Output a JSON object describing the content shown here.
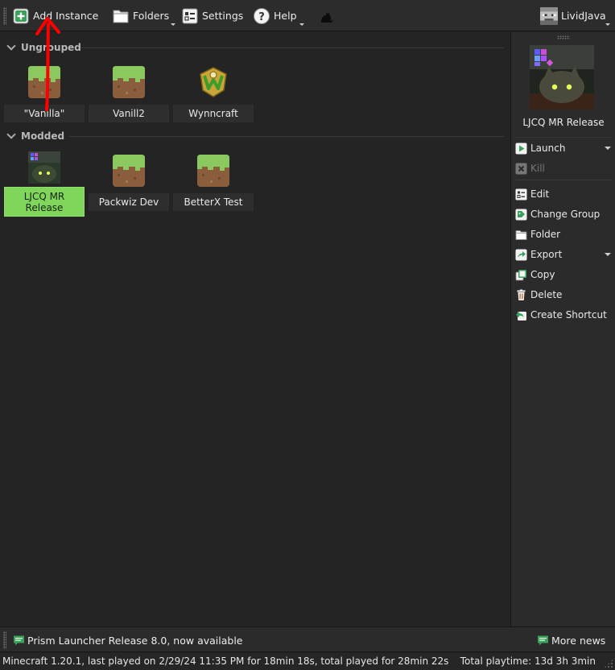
{
  "toolbar": {
    "add_instance": "Add Instance",
    "folders": "Folders",
    "settings": "Settings",
    "help": "Help",
    "account": "LividJava"
  },
  "groups": [
    {
      "name": "Ungrouped",
      "instances": [
        {
          "label": "\"Vanilla\"",
          "icon": "grass-block-icon"
        },
        {
          "label": "Vanill2",
          "icon": "grass-block-icon"
        },
        {
          "label": "Wynncraft",
          "icon": "wynncraft-logo-icon"
        }
      ]
    },
    {
      "name": "Modded",
      "instances": [
        {
          "label": "LJCQ MR Release",
          "icon": "cat-photo-icon",
          "selected": true
        },
        {
          "label": "Packwiz Dev",
          "icon": "grass-block-icon"
        },
        {
          "label": "BetterX Test",
          "icon": "grass-block-icon"
        }
      ]
    }
  ],
  "sidebar": {
    "instance_name": "LJCQ MR Release",
    "actions": {
      "launch": "Launch",
      "kill": "Kill",
      "edit": "Edit",
      "change_group": "Change Group",
      "folder": "Folder",
      "export": "Export",
      "copy": "Copy",
      "delete": "Delete",
      "create_shortcut": "Create Shortcut"
    }
  },
  "news": {
    "headline": "Prism Launcher Release 8.0, now available",
    "more_news": "More news"
  },
  "status": {
    "left": "Minecraft 1.20.1, last played on 2/29/24 11:35 PM for 18min 18s, total played for 28min 22s",
    "right": "Total playtime: 13d 3h 3min"
  },
  "colors": {
    "selection": "#7fd65b",
    "annotation": "#ff0000",
    "background": "#242424"
  }
}
